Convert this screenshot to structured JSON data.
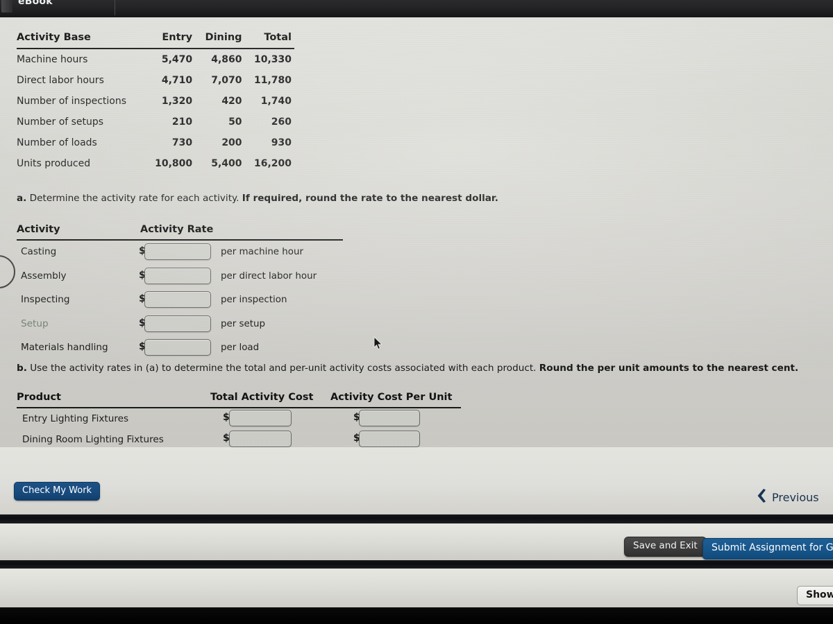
{
  "browser": {
    "tab_label": "eBook"
  },
  "activity_base_table": {
    "headers": [
      "Activity Base",
      "Entry",
      "Dining",
      "Total"
    ],
    "rows": [
      {
        "base": "Machine hours",
        "entry": "5,470",
        "dining": "4,860",
        "total": "10,330"
      },
      {
        "base": "Direct labor hours",
        "entry": "4,710",
        "dining": "7,070",
        "total": "11,780"
      },
      {
        "base": "Number of inspections",
        "entry": "1,320",
        "dining": "420",
        "total": "1,740"
      },
      {
        "base": "Number of setups",
        "entry": "210",
        "dining": "50",
        "total": "260"
      },
      {
        "base": "Number of loads",
        "entry": "730",
        "dining": "200",
        "total": "930"
      },
      {
        "base": "Units produced",
        "entry": "10,800",
        "dining": "5,400",
        "total": "16,200"
      }
    ]
  },
  "part_a": {
    "label": "a.",
    "text": "Determine the activity rate for each activity.",
    "emphasis": "If required, round the rate to the nearest dollar.",
    "headers": [
      "Activity",
      "Activity Rate"
    ],
    "dollar_sign": "$",
    "rows": [
      {
        "activity": "Casting",
        "value": "",
        "unit": "per machine hour",
        "muted": false
      },
      {
        "activity": "Assembly",
        "value": "",
        "unit": "per direct labor hour",
        "muted": false
      },
      {
        "activity": "Inspecting",
        "value": "",
        "unit": "per inspection",
        "muted": false
      },
      {
        "activity": "Setup",
        "value": "",
        "unit": "per setup",
        "muted": true
      },
      {
        "activity": "Materials handling",
        "value": "",
        "unit": "per load",
        "muted": false
      }
    ]
  },
  "part_b": {
    "label": "b.",
    "text": "Use the activity rates in (a) to determine the total and per-unit activity costs associated with each product.",
    "emphasis": "Round the per unit amounts to the nearest cent.",
    "headers": [
      "Product",
      "Total Activity Cost",
      "Activity Cost Per Unit"
    ],
    "dollar_sign": "$",
    "rows": [
      {
        "product": "Entry Lighting Fixtures",
        "total_cost": "",
        "cost_per_unit": ""
      },
      {
        "product": "Dining Room Lighting Fixtures",
        "total_cost": "",
        "cost_per_unit": ""
      }
    ]
  },
  "actions": {
    "check_my_work": "Check My Work",
    "previous": "Previous",
    "save_and_exit": "Save and Exit",
    "submit": "Submit Assignment for Grad",
    "show": "Show"
  },
  "colors": {
    "primary_blue": "#17507f",
    "submit_blue": "#17558a",
    "dark_gray_button": "#3c3c3c",
    "page_background": "#dcdcd7",
    "muted_label": "#7c8a7c"
  },
  "icons": {
    "chevron_left": "chevron-left-icon",
    "cursor": "mouse-cursor-icon"
  }
}
